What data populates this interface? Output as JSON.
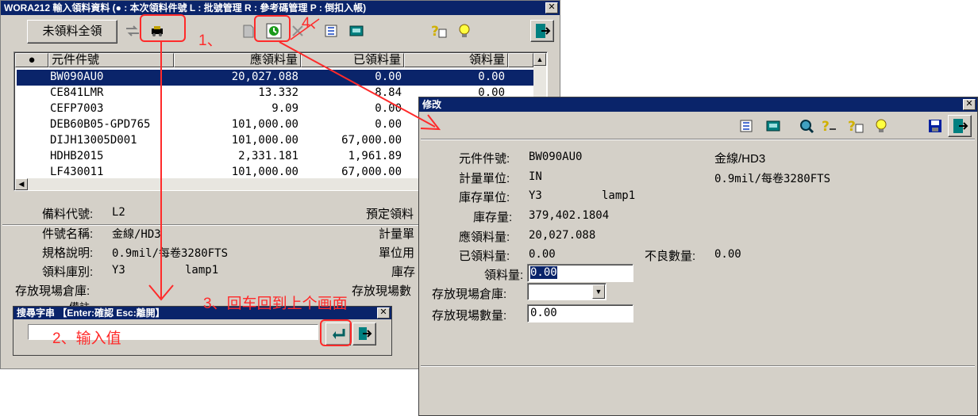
{
  "main_window": {
    "title": "WORA212 輸入領料資料 (● : 本次領料件號  L : 批號管理  R : 參考碼管理  P : 倒扣入帳)",
    "full_issue_button": "未領料全領",
    "grid": {
      "columns": [
        "●",
        "元件件號",
        "應領料量",
        "已領料量",
        "領料量"
      ],
      "rows": [
        {
          "part": "BW090AU0",
          "required": "20,027.088",
          "issued": "0.00",
          "qty": "0.00"
        },
        {
          "part": "CE841LMR",
          "required": "13.332",
          "issued": "8.84",
          "qty": "0.00"
        },
        {
          "part": "CEFP7003",
          "required": "9.09",
          "issued": "0.00",
          "qty": ""
        },
        {
          "part": "DEB60B05-GPD765",
          "required": "101,000.00",
          "issued": "0.00",
          "qty": ""
        },
        {
          "part": "DIJH13005D001",
          "required": "101,000.00",
          "issued": "67,000.00",
          "qty": ""
        },
        {
          "part": "HDHB2015",
          "required": "2,331.181",
          "issued": "1,961.89",
          "qty": ""
        },
        {
          "part": "LF430011",
          "required": "101,000.00",
          "issued": "67,000.00",
          "qty": ""
        }
      ]
    },
    "details": {
      "prep_code_label": "備料代號:",
      "prep_code": "L2",
      "part_name_label": "件號名稱:",
      "part_name": "金線/HD3",
      "spec_label": "規格說明:",
      "spec": "0.9mil/每卷3280FTS",
      "store_label": "領料庫別:",
      "store": "Y3",
      "store_extra": "lamp1",
      "site_store_label": "存放現場倉庫:",
      "planned_label": "預定領料",
      "unit_label": "計量單",
      "unit_use_label": "單位用",
      "stock_label": "庫存",
      "site_qty_label": "存放現場數",
      "partial_label": "備註"
    }
  },
  "search_dialog": {
    "title": "搜尋字串 【Enter:確認 Esc:離開】",
    "input_value": ""
  },
  "edit_dialog": {
    "title": "修改",
    "fields": [
      {
        "label": "元件件號:",
        "value": "BW090AU0",
        "extra": "金線/HD3"
      },
      {
        "label": "計量單位:",
        "value": "IN",
        "extra": "0.9mil/每卷3280FTS"
      },
      {
        "label": "庫存單位:",
        "value": "Y3",
        "extra": "lamp1"
      },
      {
        "label": "庫存量:",
        "value": "379,402.1804"
      },
      {
        "label": "應領料量:",
        "value": "20,027.088"
      },
      {
        "label": "已領料量:",
        "value": "0.00",
        "extra_label": "不良數量:",
        "extra": "0.00"
      }
    ],
    "qty_label": "領料量:",
    "qty_value": "0.00",
    "site_store_label": "存放現場倉庫:",
    "site_store_value": "",
    "site_qty_label": "存放現場數量:",
    "site_qty_value": "0.00"
  },
  "annotations": {
    "step1": "1、",
    "step2": "2、输入值",
    "step3": "3、回车回到上个画面",
    "step4": "4、"
  },
  "colors": {
    "title_bar": "#0a246a",
    "selection": "#0a246a",
    "window_bg": "#d4d0c8",
    "annotation": "#ff2a2a"
  }
}
